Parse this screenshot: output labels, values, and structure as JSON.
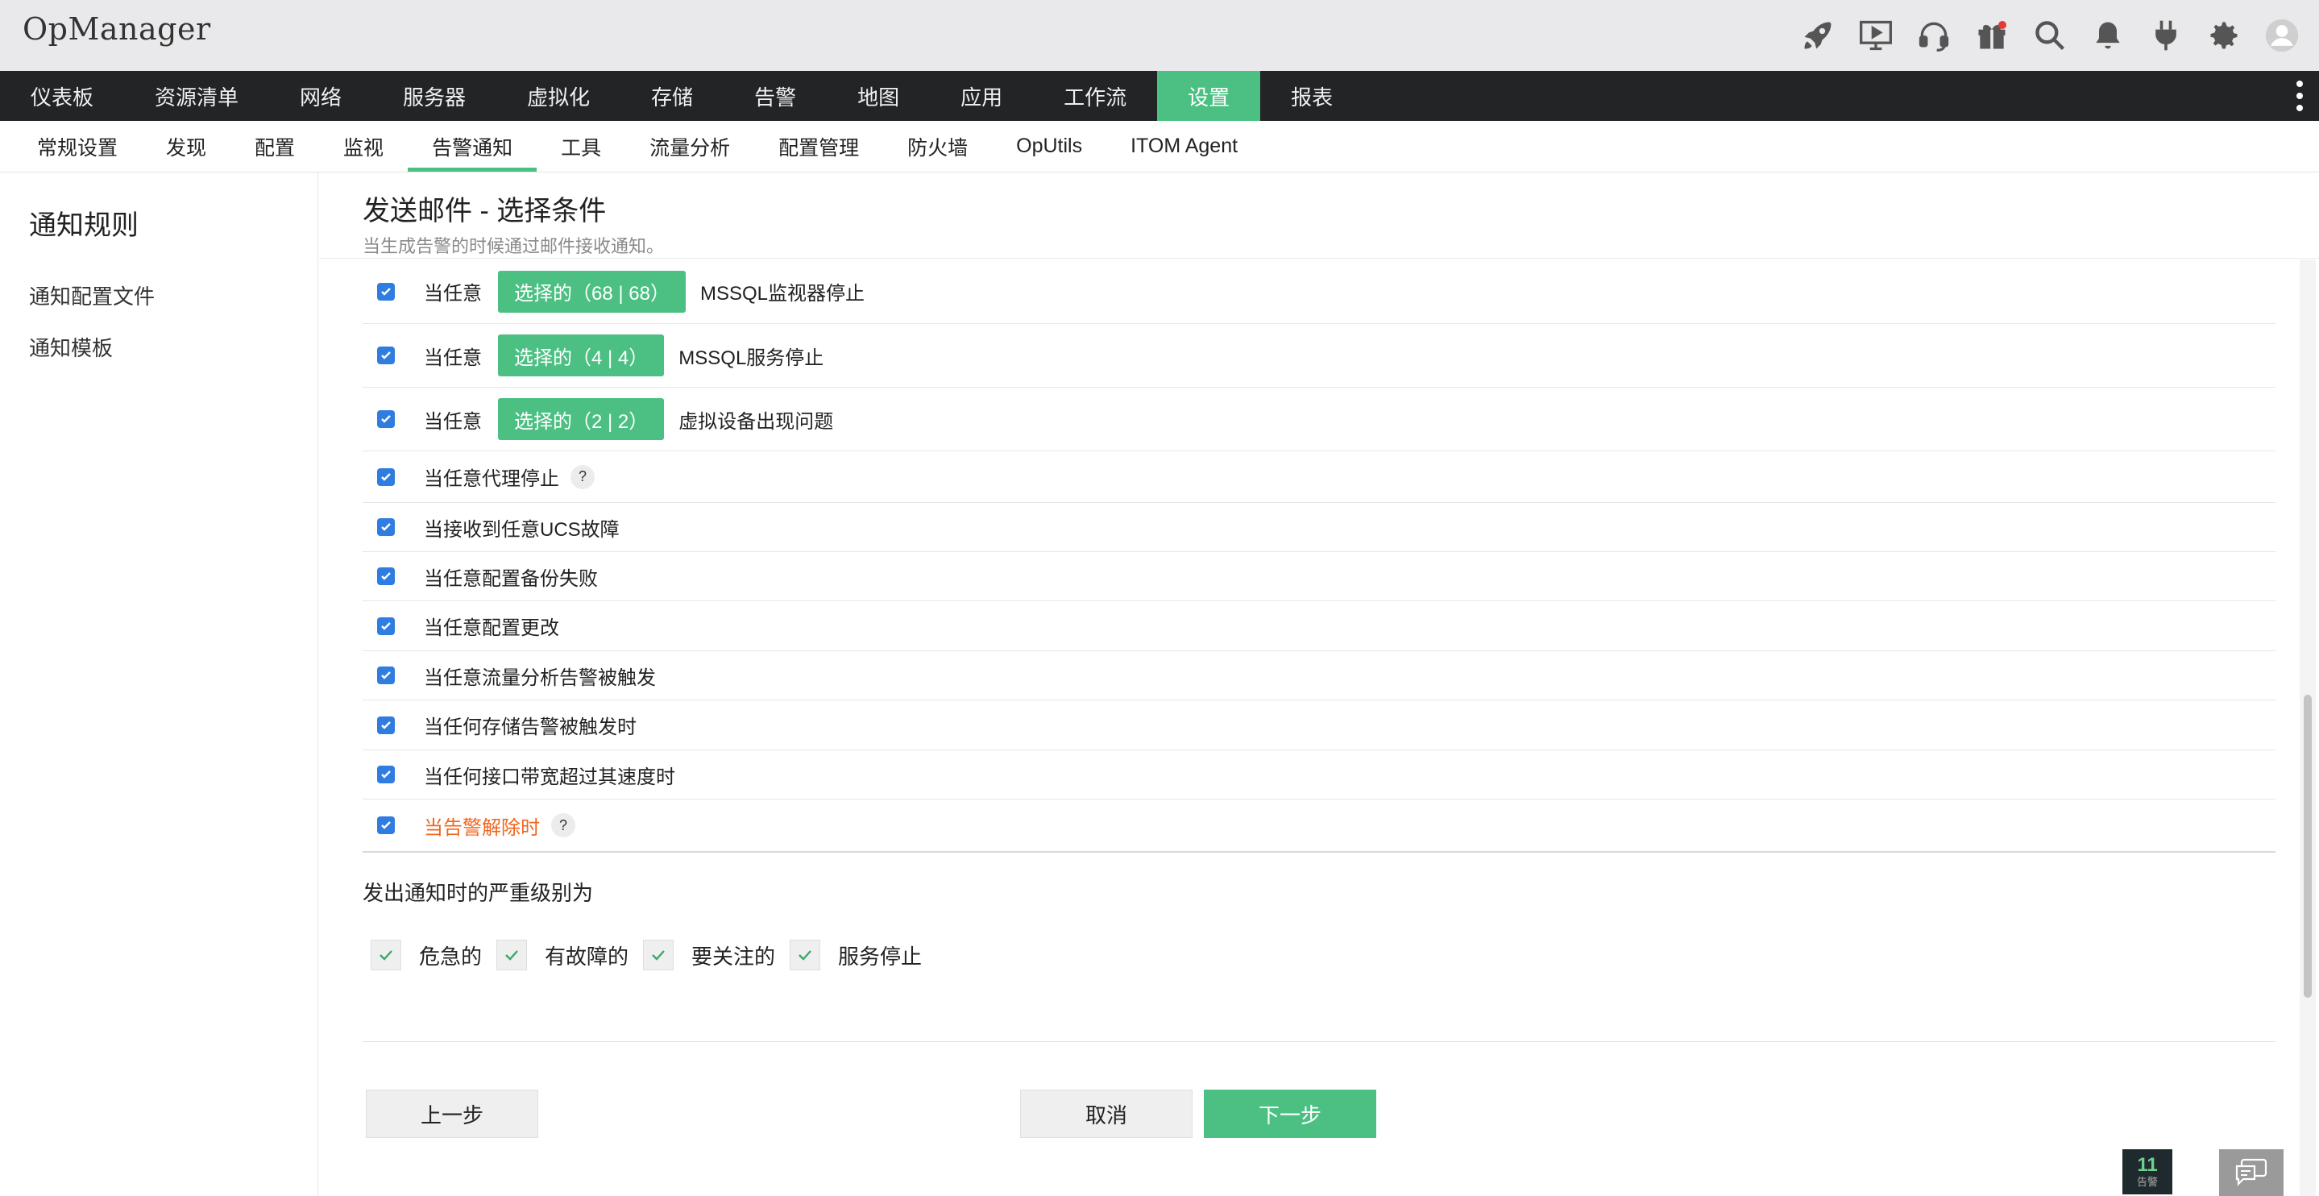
{
  "app": {
    "logo": "OpManager"
  },
  "top_icons": [
    "rocket-icon",
    "presentation-icon",
    "headset-icon",
    "gift-icon",
    "search-icon",
    "bell-icon",
    "plug-icon",
    "gear-icon",
    "avatar-icon"
  ],
  "main_nav": {
    "items": [
      "仪表板",
      "资源清单",
      "网络",
      "服务器",
      "虚拟化",
      "存储",
      "告警",
      "地图",
      "应用",
      "工作流",
      "设置",
      "报表"
    ],
    "active": "设置"
  },
  "sub_nav": {
    "items": [
      "常规设置",
      "发现",
      "配置",
      "监视",
      "告警通知",
      "工具",
      "流量分析",
      "配置管理",
      "防火墙",
      "OpUtils",
      "ITOM Agent"
    ],
    "active": "告警通知"
  },
  "left_panel": {
    "title": "通知规则",
    "links": [
      "通知配置文件",
      "通知模板"
    ]
  },
  "page": {
    "title": "发送邮件 - 选择条件",
    "description": "当生成告警的时候通过邮件接收通知。"
  },
  "criteria": [
    {
      "prefix": "当任意",
      "button": "选择的（68 | 68）",
      "suffix": "MSSQL监视器停止",
      "checked": true
    },
    {
      "prefix": "当任意",
      "button": "选择的（4 | 4）",
      "suffix": "MSSQL服务停止",
      "checked": true
    },
    {
      "prefix": "当任意",
      "button": "选择的（2 | 2）",
      "suffix": "虚拟设备出现问题",
      "checked": true
    },
    {
      "prefix": "当任意代理停止",
      "help": "?",
      "checked": true
    },
    {
      "prefix": "当接收到任意UCS故障",
      "checked": true
    },
    {
      "prefix": "当任意配置备份失败",
      "checked": true
    },
    {
      "prefix": "当任意配置更改",
      "checked": true
    },
    {
      "prefix": "当任意流量分析告警被触发",
      "checked": true
    },
    {
      "prefix": "当任何存储告警被触发时",
      "checked": true
    },
    {
      "prefix": "当任何接口带宽超过其速度时",
      "checked": true
    },
    {
      "prefix": "当告警解除时",
      "help": "?",
      "checked": true,
      "highlight": true
    }
  ],
  "severity": {
    "title": "发出通知时的严重级别为",
    "levels": [
      {
        "label": "危急的",
        "checked": true
      },
      {
        "label": "有故障的",
        "checked": true
      },
      {
        "label": "要关注的",
        "checked": true
      },
      {
        "label": "服务停止",
        "checked": true
      }
    ]
  },
  "buttons": {
    "prev": "上一步",
    "cancel": "取消",
    "next": "下一步"
  },
  "alarm_widget": {
    "count": "11",
    "label": "告警"
  },
  "colors": {
    "accent": "#4cc083",
    "nav_bg": "#222426",
    "checkbox": "#2f7de1",
    "alert_text": "#f0661e"
  }
}
